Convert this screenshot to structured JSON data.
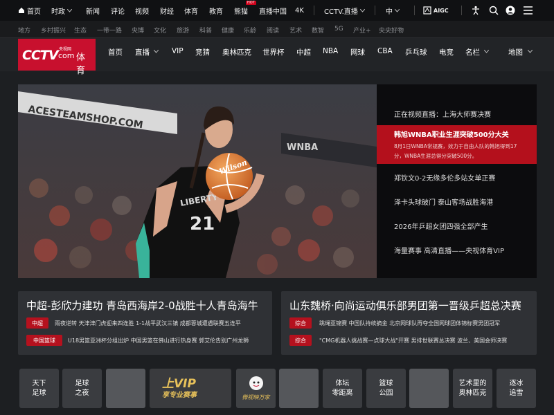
{
  "topbar": {
    "items": [
      "首页",
      "时政",
      "新闻",
      "评论",
      "视频",
      "财经",
      "体育",
      "教育",
      "熊猫",
      "直播中国",
      "4K",
      "CCTV.直播",
      "中"
    ],
    "hot_badge": "HOT",
    "aigc": "AIGC"
  },
  "subnav": [
    "地方",
    "乡村振兴",
    "生态",
    "一带一路",
    "央博",
    "文化",
    "旅游",
    "科普",
    "健康",
    "乐龄",
    "阅读",
    "艺术",
    "数智",
    "5G",
    "产业+",
    "央央好物"
  ],
  "logo": {
    "cctv": "CCTV",
    "com": "com",
    "site": "央视网",
    "sport": "体育"
  },
  "mainnav": [
    "首页",
    "直播",
    "VIP",
    "竞猜",
    "奥林匹克",
    "世界杯",
    "中超",
    "NBA",
    "网球",
    "CBA",
    "乒乓球",
    "电竞",
    "名栏",
    "地图"
  ],
  "hero": {
    "banner_text": "ACESTEAMSHOP.COM",
    "wnba_text": "WNBA",
    "jersey_team": "LIBERTY",
    "jersey_number": "21",
    "ball_brand": "Wilson"
  },
  "side_list": [
    {
      "text": "正在视频直播：上海大师赛决赛"
    },
    {
      "text": "韩旭WNBA职业生涯突破500分大关",
      "desc": "8月1日WNBA常规赛，效力于自由人队的韩旭得到17分，WNBA生涯总得分突破500分。"
    },
    {
      "text": "郑钦文0-2无缘多伦多站女单正赛"
    },
    {
      "text": "泽卡头球破门 泰山客场战胜海港"
    },
    {
      "text": "2026年乒超女团四强全部产生"
    },
    {
      "text": "海量赛事 高清直播——央视体育VIP"
    }
  ],
  "cards": [
    {
      "title": "中超-彭欣力建功 青岛西海岸2-0战胜十人青岛海牛",
      "rows": [
        {
          "tag": "中超",
          "text": "雨夜逆转 天津津门虎迎来四连胜 1-1战平武汉三镇 成都蓉城遭遇联赛五连平"
        },
        {
          "tag": "中国篮球",
          "text": "U18男篮亚洲杯分组出炉 中国男篮在佛山进行热身赛 郭艾伦告别广州龙狮"
        }
      ]
    },
    {
      "title": "山东魏桥·向尚运动俱乐部男团第一晋级乒超总决赛",
      "rows": [
        {
          "tag": "综合",
          "text": "跳绳亚锦赛 中国队持续摘金 北京网球队再夺全国网球团体锦标赛男团冠军"
        },
        {
          "tag": "综合",
          "text": "\"CMG机器人挑战赛—点球大战\"开赛 男排世联赛总决赛 波兰、美国会师决赛"
        }
      ]
    }
  ],
  "tiles": [
    {
      "line1": "天下",
      "line2": "足球"
    },
    {
      "line1": "足球",
      "line2": "之夜"
    },
    {
      "line1": "",
      "line2": ""
    },
    {
      "line1": "上VIP",
      "line2": "享专业赛事"
    },
    {
      "line1": "微视映万家",
      "line2": ""
    },
    {
      "line1": "",
      "line2": ""
    },
    {
      "line1": "体坛",
      "line2": "零距离"
    },
    {
      "line1": "篮球",
      "line2": "公园"
    },
    {
      "line1": "",
      "line2": ""
    },
    {
      "line1": "艺术里的",
      "line2": "奥林匹克"
    },
    {
      "line1": "逐冰",
      "line2": "追雪"
    }
  ],
  "colors": {
    "accent": "#c8102e",
    "gold": "#e7c15a"
  }
}
